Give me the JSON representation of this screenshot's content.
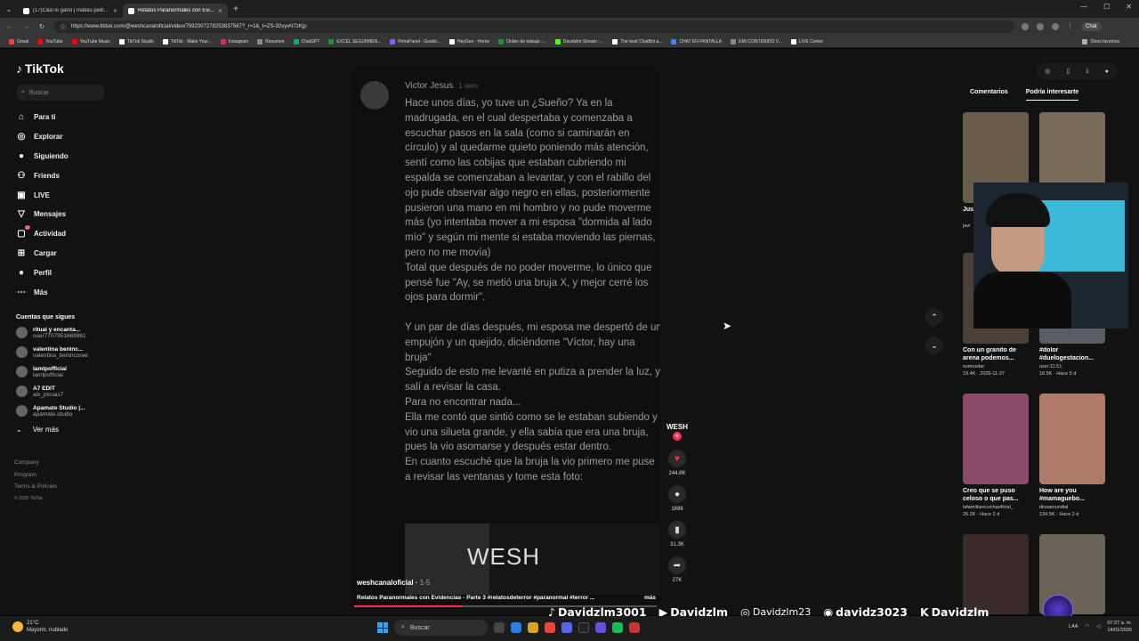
{
  "browser": {
    "tabs": [
      {
        "title": "(17)Casi lo gano | matias peditos |",
        "active": false
      },
      {
        "title": "Relatos Paranormales con Evi...",
        "active": true
      }
    ],
    "url": "https://www.tiktok.com/@weshcanaloficial/video/7592007278253837567?_r=1&_t=ZS-92vyvH7zKjp",
    "chat_label": "Chat",
    "bookmarks": [
      "Gmail",
      "YouTube",
      "YouTube Music",
      "TikTok Studio",
      "TikTok - Make Your...",
      "Instagram",
      "Resumen",
      "ChatGPT",
      "EXCEL SEGUIMIEN...",
      "PetraPanel - Gestió...",
      "HeyGen - Home",
      "Orden de trabajo -...",
      "Davidzlm Stream -...",
      "The best ChatBot a...",
      "CHAT EN PANTALLA",
      "EMI CONTENIDO V...",
      "LIVE Center"
    ],
    "bookmarks_other": "Otros favoritos"
  },
  "sidebar": {
    "logo": "TikTok",
    "search_placeholder": "Buscar",
    "nav": [
      {
        "label": "Para ti",
        "icon": "home-icon"
      },
      {
        "label": "Explorar",
        "icon": "compass-icon"
      },
      {
        "label": "Siguiendo",
        "icon": "following-icon"
      },
      {
        "label": "Friends",
        "icon": "friends-icon"
      },
      {
        "label": "LIVE",
        "icon": "live-icon"
      },
      {
        "label": "Mensajes",
        "icon": "message-icon"
      },
      {
        "label": "Actividad",
        "icon": "activity-icon",
        "badge": "17"
      },
      {
        "label": "Cargar",
        "icon": "upload-icon"
      },
      {
        "label": "Perfil",
        "icon": "profile-icon"
      },
      {
        "label": "Más",
        "icon": "more-icon"
      }
    ],
    "following_title": "Cuentas que sigues",
    "following": [
      {
        "name": "ritual y encanta...",
        "handle": "user7707951669861"
      },
      {
        "name": "valentina beninc...",
        "handle": "valentina_benincoree"
      },
      {
        "name": "lamlpofficial",
        "handle": "lamlpofficial"
      },
      {
        "name": "A7 EDIT",
        "handle": "alx_picuas7"
      },
      {
        "name": "Apamate Studio |...",
        "handle": "apamate.studio"
      }
    ],
    "see_more": "Ver más",
    "footer": [
      "Company",
      "Program",
      "Terms & Policies"
    ],
    "copyright": "© 2026 TikTok"
  },
  "video": {
    "comment_author": "Victor Jesus",
    "comment_time": "1 sem",
    "comment_paragraphs": [
      "Hace unos días, yo tuve un ¿Sueño? Ya en la madrugada, en el cual despertaba y comenzaba a escuchar pasos en la sala (como si caminarán en círculo) y al quedarme quieto poniendo más atención, sentí como las cobijas que estaban cubriendo mi espalda se comenzaban a levantar, y con el rabillo del ojo pude observar algo negro en ellas, posteriormente pusieron una mano en mi hombro y no pude moverme más (yo intentaba mover a mi esposa \"dormida al lado mío\" y según mi mente si estaba moviendo las piernas, pero no me movía)",
      "Total que después de no poder moverme, lo único que pensé fue \"Ay, se metió una bruja X, y mejor cerré los ojos para dormir\".",
      "",
      "Y un par de días después, mi esposa me despertó de un empujón y un quejido, diciéndome \"Víctor, hay una bruja\"",
      "Seguido de esto me levanté en putiza a prender la luz, y salí a revisar la casa.",
      "Para no encontrar nada...",
      "Ella me contó que sintió como se le estaban subiendo y vio una silueta grande, y ella sabía que era una bruja, pues la vio asomarse y después estar dentro.",
      "En cuanto escuché que la bruja la vio primero me puse a revisar las ventanas y tome esta foto:"
    ],
    "watermark": "WESH",
    "creator": "weshcanaloficial",
    "creator_date": "1-5",
    "description": "Relatos Paranormales con Evidencias - Parte 3 #relatosdeterror #paranormal #terror ...",
    "more": "más",
    "progress": 0.36
  },
  "actions": {
    "creator_tag": "WESH",
    "likes": "244.8K",
    "comments": "1696",
    "saves": "31.3K",
    "shares": "27K"
  },
  "right_panel": {
    "tabs": [
      "Comentarios",
      "Podría interesarte"
    ],
    "active_tab": "Podría interesarte",
    "cards": [
      {
        "title": "Jus... lo c...",
        "author": "javi",
        "stats": ""
      },
      {
        "title": "",
        "author": "",
        "stats": ""
      },
      {
        "title": "Con un granito de arena podemos...",
        "author": "somosdar",
        "stats": "19.4K · 2025-11-27"
      },
      {
        "title": "#dolor #duelogestacion...",
        "author": "user.11.51",
        "stats": "18.5K · Hace 5 d"
      },
      {
        "title": "Creo que se puso celoso o que pas...",
        "author": "lafamiliarecochaoficial_",
        "stats": "26.2K · Hace 2 d"
      },
      {
        "title": "How are you #mamaguebo...",
        "author": "diosamundial",
        "stats": "134.5K · Hace 2 d"
      }
    ]
  },
  "overlay": {
    "tiktok": "Davidzlm3001",
    "youtube": "Davidzlm",
    "instagram": "Davidzlm23",
    "discord": "davidz3023",
    "kick": "Davidzlm",
    "badge": "DAVIDZ"
  },
  "taskbar": {
    "temp": "21°C",
    "weather": "Mayorm. nublado",
    "search": "Buscar",
    "time": "07:27 a. m.",
    "date": "14/01/2026",
    "lang": "LAA"
  },
  "colors": {
    "accent": "#fe2c55",
    "bg": "#121212"
  }
}
